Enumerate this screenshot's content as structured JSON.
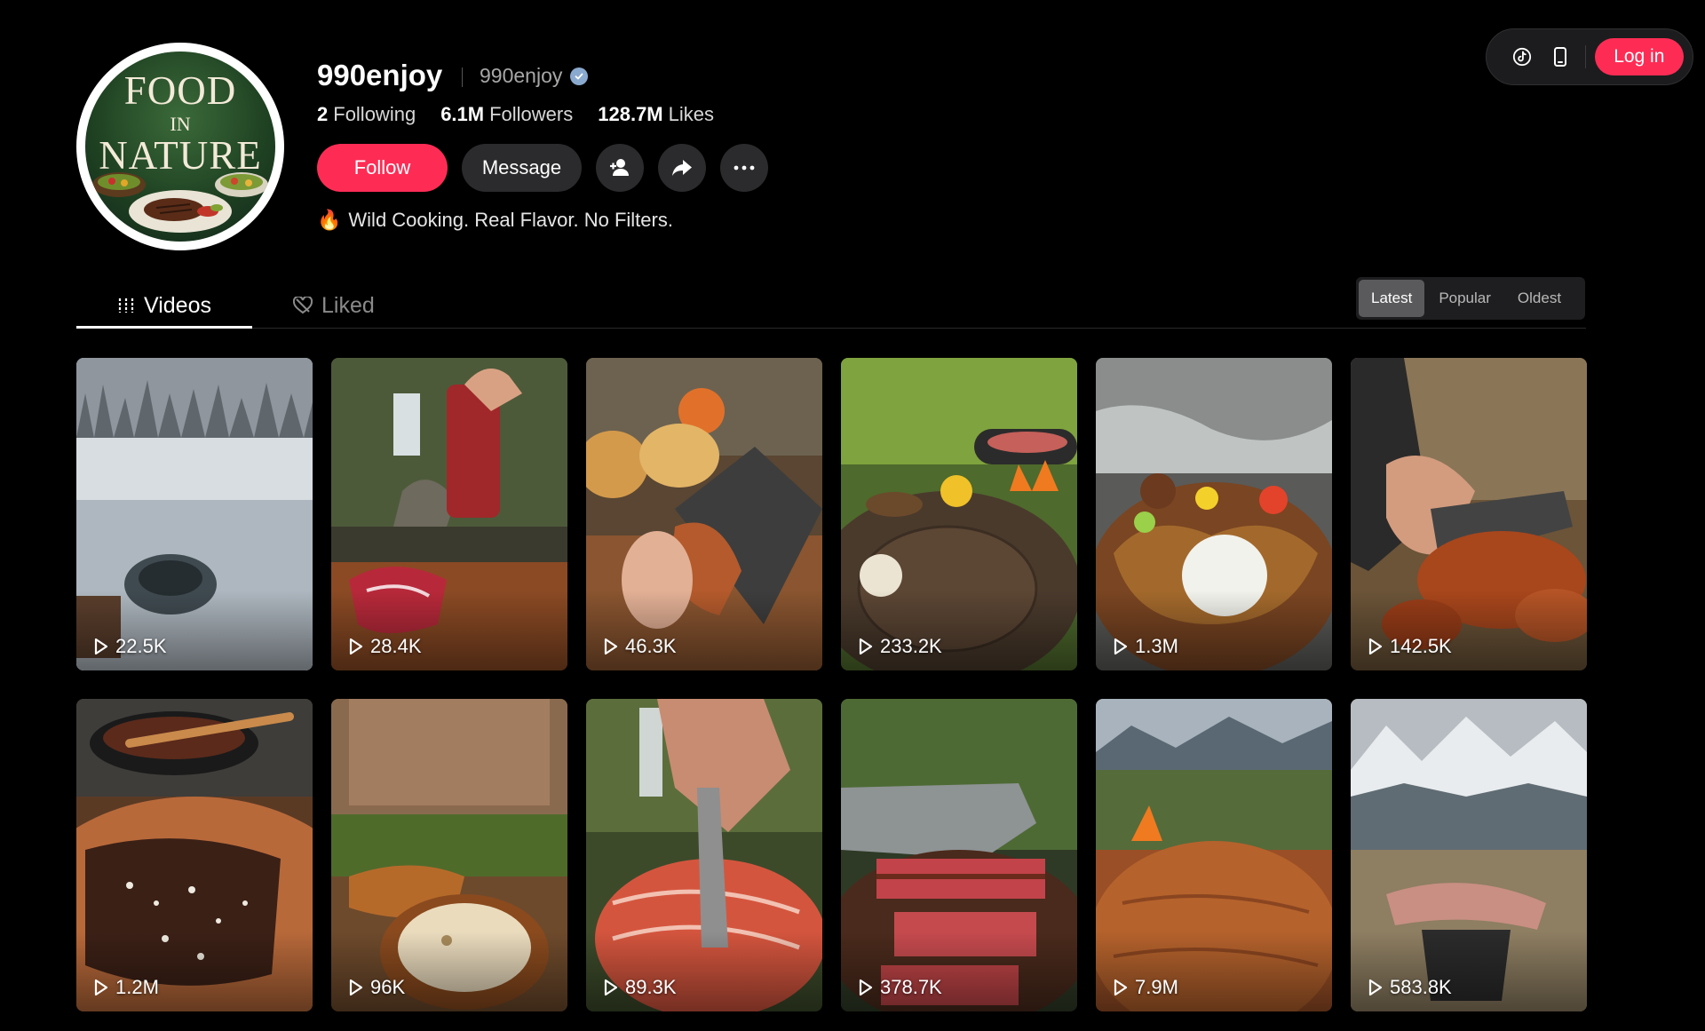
{
  "topbar": {
    "icons": [
      "tiktok-icon",
      "phone-icon"
    ],
    "login_label": "Log in"
  },
  "profile": {
    "avatar_line1": "FOOD",
    "avatar_line2": "IN",
    "avatar_line3": "NATURE",
    "username": "990enjoy",
    "handle": "990enjoy",
    "verified": true,
    "stats": [
      {
        "value": "2",
        "label": "Following"
      },
      {
        "value": "6.1M",
        "label": "Followers"
      },
      {
        "value": "128.7M",
        "label": "Likes"
      }
    ],
    "follow_label": "Follow",
    "message_label": "Message",
    "bio": "Wild Cooking. Real Flavor. No Filters.",
    "bio_emoji": "🔥"
  },
  "tabs": {
    "videos_label": "Videos",
    "liked_label": "Liked",
    "active": "Videos"
  },
  "sort": {
    "options": [
      "Latest",
      "Popular",
      "Oldest"
    ],
    "active": "Latest"
  },
  "videos": [
    {
      "views": "22.5K",
      "scene": "snowy-lake"
    },
    {
      "views": "28.4K",
      "scene": "steak-waterfall"
    },
    {
      "views": "46.3K",
      "scene": "bread-cleaver"
    },
    {
      "views": "233.2K",
      "scene": "forest-skillet"
    },
    {
      "views": "1.3M",
      "scene": "river-fish-rice"
    },
    {
      "views": "142.5K",
      "scene": "potato-cleaver"
    },
    {
      "views": "1.2M",
      "scene": "bruschetta-skillet"
    },
    {
      "views": "96K",
      "scene": "sandwich-dip"
    },
    {
      "views": "89.3K",
      "scene": "salmon-knife"
    },
    {
      "views": "378.7K",
      "scene": "steak-slices"
    },
    {
      "views": "7.9M",
      "scene": "mountain-board"
    },
    {
      "views": "583.8K",
      "scene": "alpine-ribs"
    }
  ],
  "colors": {
    "accent": "#fe2c55",
    "background": "#000000",
    "button_dark": "#2b2b2d"
  }
}
